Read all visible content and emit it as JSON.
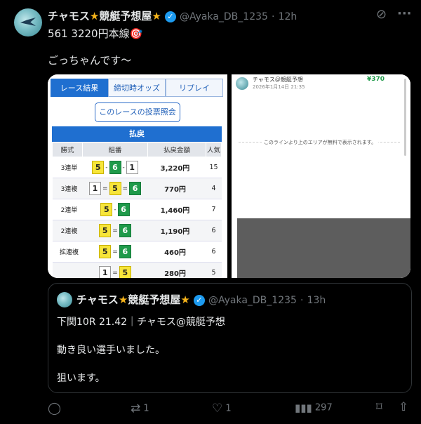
{
  "post": {
    "display_name": "チャモス⭐競艇予想屋⭐",
    "name_part1": "チャモス",
    "name_part2": "競艇予想屋",
    "handle": "@Ayaka_DB_1235",
    "time": "12h",
    "line1": "561 3220円本線🎯",
    "line2": "ごっちゃんです〜"
  },
  "result_page": {
    "tabs": [
      "レース結果",
      "締切時オッズ",
      "リプレイ"
    ],
    "vote_button": "このレースの投票照会",
    "section_title": "払戻",
    "headers": [
      "勝式",
      "組番",
      "払戻金額",
      "人気"
    ],
    "rows": [
      {
        "kind": "3連単",
        "combo": [
          "5",
          "-",
          "6",
          "-",
          "1"
        ],
        "amount": "3,220円",
        "pop": "15"
      },
      {
        "kind": "3連複",
        "combo": [
          "1",
          "=",
          "5",
          "=",
          "6"
        ],
        "amount": "770円",
        "pop": "4"
      },
      {
        "kind": "2連単",
        "combo": [
          "5",
          "-",
          "6"
        ],
        "amount": "1,460円",
        "pop": "7"
      },
      {
        "kind": "2連複",
        "combo": [
          "5",
          "=",
          "6"
        ],
        "amount": "1,190円",
        "pop": "6"
      },
      {
        "kind": "拡連複",
        "combo": [
          "5",
          "=",
          "6"
        ],
        "amount": "460円",
        "pop": "6"
      },
      {
        "kind": "",
        "combo": [
          "1",
          "=",
          "5"
        ],
        "amount": "280円",
        "pop": "5"
      }
    ]
  },
  "note_page": {
    "author": "チャモス＠競艇予想",
    "date": "2026年1月14日 21:35",
    "price": "¥370",
    "free_notice": "このラインより上のエリアが無料で表示されます。"
  },
  "quoted": {
    "display_name": "チャモス⭐競艇予想屋⭐",
    "name_part1": "チャモス",
    "name_part2": "競艇予想屋",
    "handle": "@Ayaka_DB_1235",
    "time": "13h",
    "line1": "下関10R 21.42｜チャモス@競艇予想",
    "line2": "動き良い選手いました。",
    "line3": "狙います。"
  },
  "actions": {
    "reply": "",
    "repost": "1",
    "like": "1",
    "views": "297"
  },
  "colors": {
    "background": "#000000",
    "text": "#e7e9ea",
    "muted": "#71767b",
    "verified": "#1d9bf0",
    "boat_yellow": "#f7e53a",
    "boat_green": "#1f9a4a",
    "tab_blue": "#1f6fd0",
    "price_green": "#1f9a4a"
  }
}
